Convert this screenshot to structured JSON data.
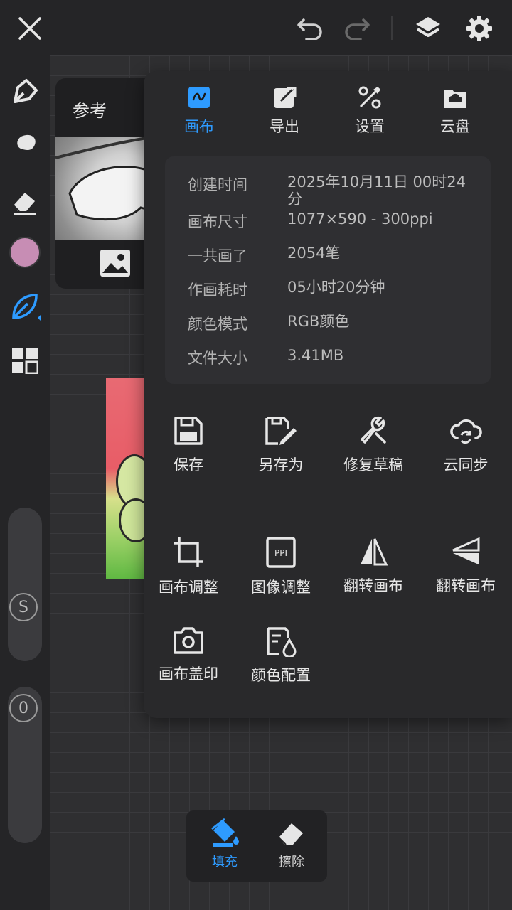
{
  "topbar": {
    "close_icon": "close-icon",
    "undo_icon": "undo-icon",
    "redo_icon": "redo-icon",
    "layers_icon": "layers-icon",
    "settings_icon": "gear-icon"
  },
  "sidebar": {
    "tools": [
      "pen-icon",
      "smudge-icon",
      "eraser-icon",
      "color-swatch",
      "leaf-brush-icon",
      "grid-icon"
    ],
    "color": "#c78db4",
    "size_knob": "S",
    "opacity_knob": "0"
  },
  "reference": {
    "title": "参考"
  },
  "popup": {
    "tabs": [
      {
        "label": "画布",
        "icon": "canvas-icon",
        "active": true
      },
      {
        "label": "导出",
        "icon": "export-icon",
        "active": false
      },
      {
        "label": "设置",
        "icon": "settings-tools-icon",
        "active": false
      },
      {
        "label": "云盘",
        "icon": "cloud-drive-icon",
        "active": false
      }
    ],
    "info": [
      {
        "key": "创建时间",
        "value": "2025年10月11日 00时24分"
      },
      {
        "key": "画布尺寸",
        "value": "1077×590 - 300ppi"
      },
      {
        "key": "一共画了",
        "value": "2054笔"
      },
      {
        "key": "作画耗时",
        "value": "05小时20分钟"
      },
      {
        "key": "颜色模式",
        "value": "RGB颜色"
      },
      {
        "key": "文件大小",
        "value": "3.41MB"
      }
    ],
    "actions_row1": [
      {
        "label": "保存",
        "icon": "save-icon"
      },
      {
        "label": "另存为",
        "icon": "save-as-icon"
      },
      {
        "label": "修复草稿",
        "icon": "repair-icon"
      },
      {
        "label": "云同步",
        "icon": "cloud-sync-icon"
      }
    ],
    "actions_row2": [
      {
        "label": "画布调整",
        "icon": "crop-icon"
      },
      {
        "label": "图像调整",
        "icon": "ppi-icon"
      },
      {
        "label": "翻转画布",
        "icon": "flip-horizontal-icon"
      },
      {
        "label": "翻转画布",
        "icon": "flip-vertical-icon"
      }
    ],
    "actions_row3": [
      {
        "label": "画布盖印",
        "icon": "camera-icon"
      },
      {
        "label": "颜色配置",
        "icon": "color-profile-icon"
      }
    ]
  },
  "bottom_bar": {
    "fill_label": "填充",
    "erase_label": "擦除"
  },
  "accent": "#2e9bff"
}
